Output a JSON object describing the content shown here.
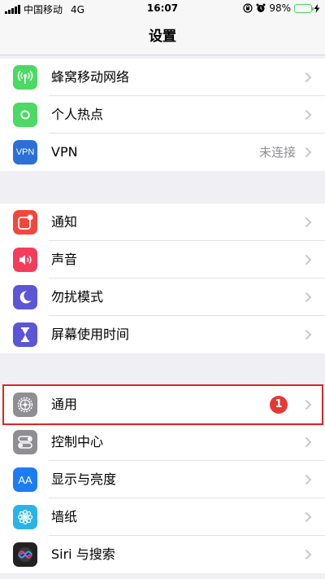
{
  "status_bar": {
    "carrier": "中国移动",
    "network": "4G",
    "time": "16:07",
    "battery_pct": "98%",
    "battery_level": 0.98,
    "icons": [
      "signal-icon",
      "rotation-lock-icon",
      "alarm-icon",
      "battery-icon",
      "charging-icon"
    ]
  },
  "nav": {
    "title": "设置"
  },
  "groups": {
    "connectivity": [
      {
        "label": "蜂窝移动网络",
        "icon": "cellular-icon",
        "color": "#4cd964"
      },
      {
        "label": "个人热点",
        "icon": "hotspot-icon",
        "color": "#4cd964"
      },
      {
        "label": "VPN",
        "value": "未连接",
        "icon": "vpn-icon",
        "icon_text": "VPN",
        "color": "#2c6fd6"
      }
    ],
    "notifications": [
      {
        "label": "通知",
        "icon": "notifications-icon",
        "color": "#f6453a"
      },
      {
        "label": "声音",
        "icon": "sound-icon",
        "color": "#f43d5c"
      },
      {
        "label": "勿扰模式",
        "icon": "do-not-disturb-icon",
        "color": "#5b56d6"
      },
      {
        "label": "屏幕使用时间",
        "icon": "screen-time-icon",
        "color": "#5b56d6"
      }
    ],
    "system": [
      {
        "label": "通用",
        "badge": "1",
        "icon": "gear-icon",
        "color": "#8e8e93",
        "highlighted": true
      },
      {
        "label": "控制中心",
        "icon": "control-center-icon",
        "color": "#8e8e93"
      },
      {
        "label": "显示与亮度",
        "icon": "display-brightness-icon",
        "icon_text": "AA",
        "color": "#1e7cf2"
      },
      {
        "label": "墙纸",
        "icon": "wallpaper-icon",
        "color": "#2ab3e8"
      },
      {
        "label": "Siri 与搜索",
        "icon": "siri-icon",
        "color": "#222222"
      }
    ]
  }
}
